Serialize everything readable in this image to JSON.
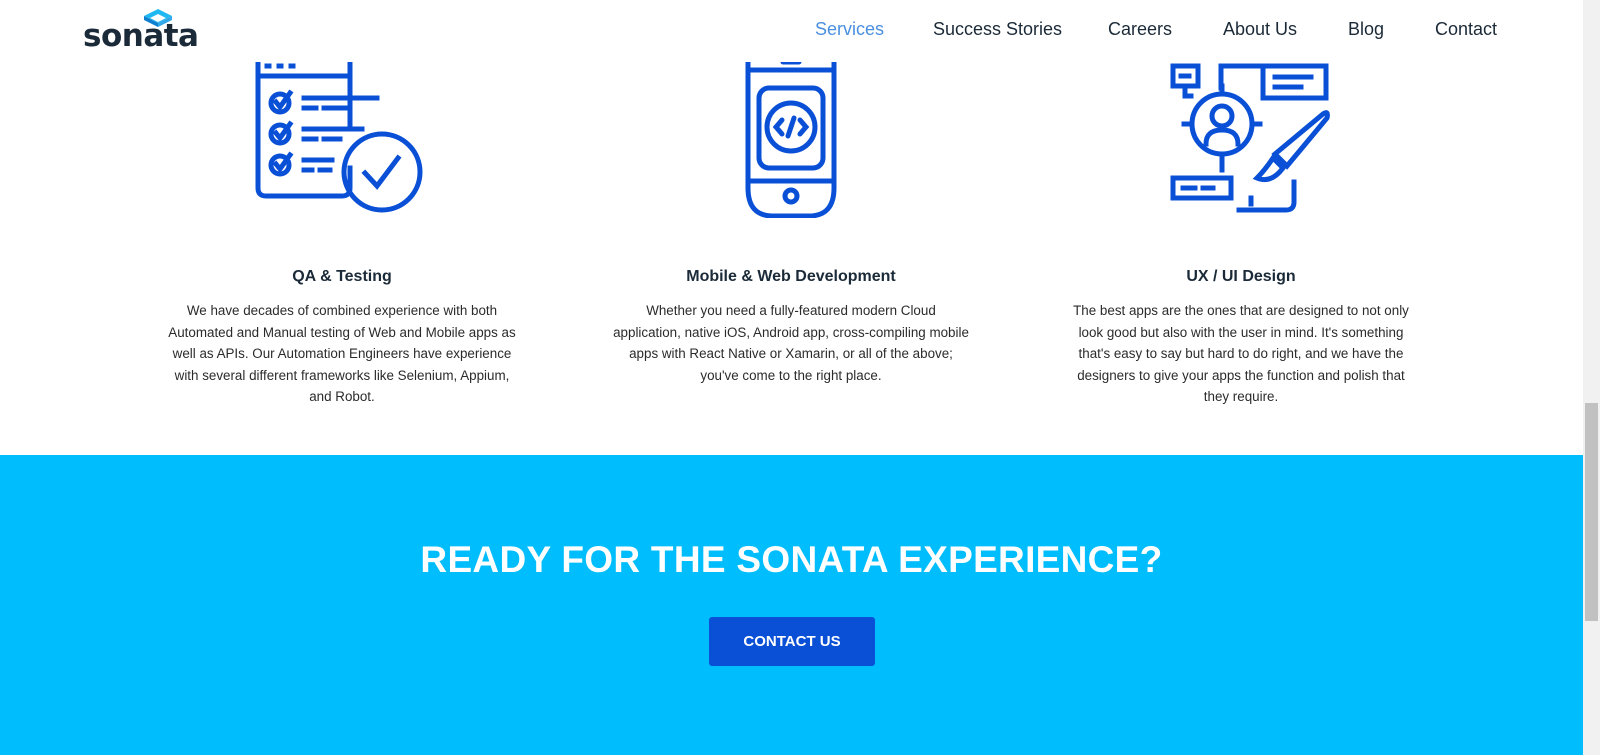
{
  "brand": {
    "name": "sonata",
    "primary": "#0a50d7",
    "accent": "#00bdfd",
    "nav_active": "#4a8fe0",
    "text": "#1b2a38"
  },
  "nav": {
    "items": [
      {
        "label": "Services",
        "active": true
      },
      {
        "label": "Success Stories",
        "active": false
      },
      {
        "label": "Careers",
        "active": false
      },
      {
        "label": "About Us",
        "active": false
      },
      {
        "label": "Blog",
        "active": false
      },
      {
        "label": "Contact",
        "active": false
      }
    ]
  },
  "services": [
    {
      "icon": "checklist-icon",
      "title": "QA & Testing",
      "description": "We have decades of combined experience with both Automated and Manual testing of Web and Mobile apps as well as APIs. Our Automation Engineers have experience with several different frameworks like Selenium, Appium, and Robot."
    },
    {
      "icon": "mobile-code-icon",
      "title": "Mobile & Web Development",
      "description": "Whether you need a fully-featured modern Cloud application, native iOS, Android app, cross-compiling mobile apps with React Native or Xamarin, or all of the above; you've come to the right place."
    },
    {
      "icon": "design-target-icon",
      "title": "UX / UI Design",
      "description": "The best apps are the ones that are designed to not only look good but also with the user in mind. It's something that's easy to say but hard to do right, and we have the designers to give your apps the function and polish that they require."
    }
  ],
  "cta": {
    "heading": "READY FOR THE SONATA EXPERIENCE?",
    "button_label": "CONTACT US"
  }
}
